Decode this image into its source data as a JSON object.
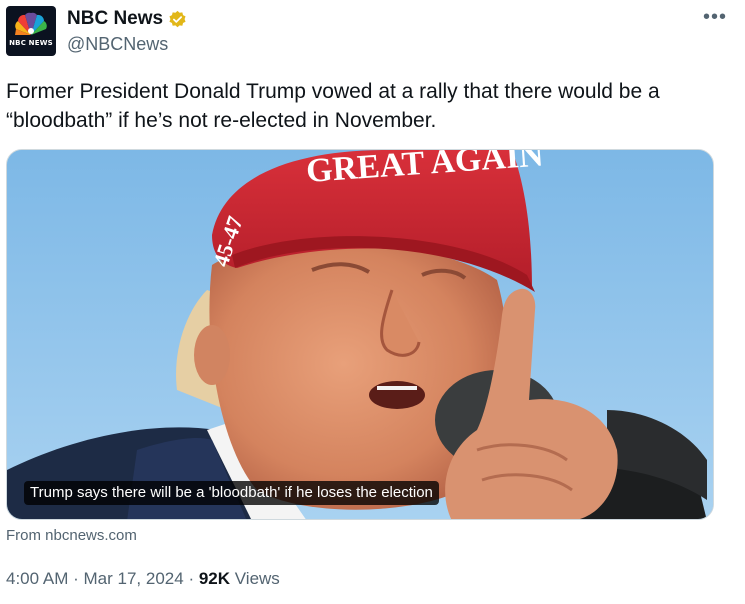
{
  "account": {
    "display_name": "NBC News",
    "handle": "@NBCNews",
    "avatar_text": "NBC NEWS",
    "verified": true
  },
  "more_icon": "more-options-icon",
  "tweet": {
    "text": "Former President Donald Trump vowed at a rally that there would be a “bloodbath” if he’s not re-elected in November."
  },
  "media": {
    "cap_text": "GREAT AGAIN",
    "cap_side_text": "45-47",
    "caption": "Trump says there will be a 'bloodbath' if he loses the election"
  },
  "link_source": "From nbcnews.com",
  "meta": {
    "time": "4:00 AM",
    "separator": "·",
    "date": "Mar 17, 2024",
    "views_count": "92K",
    "views_label": "Views"
  },
  "colors": {
    "text": "#0f1419",
    "secondary": "#536471",
    "verified_gold": "#e2b719",
    "sky": "#8fc3ea",
    "cap_red": "#c8202d"
  }
}
